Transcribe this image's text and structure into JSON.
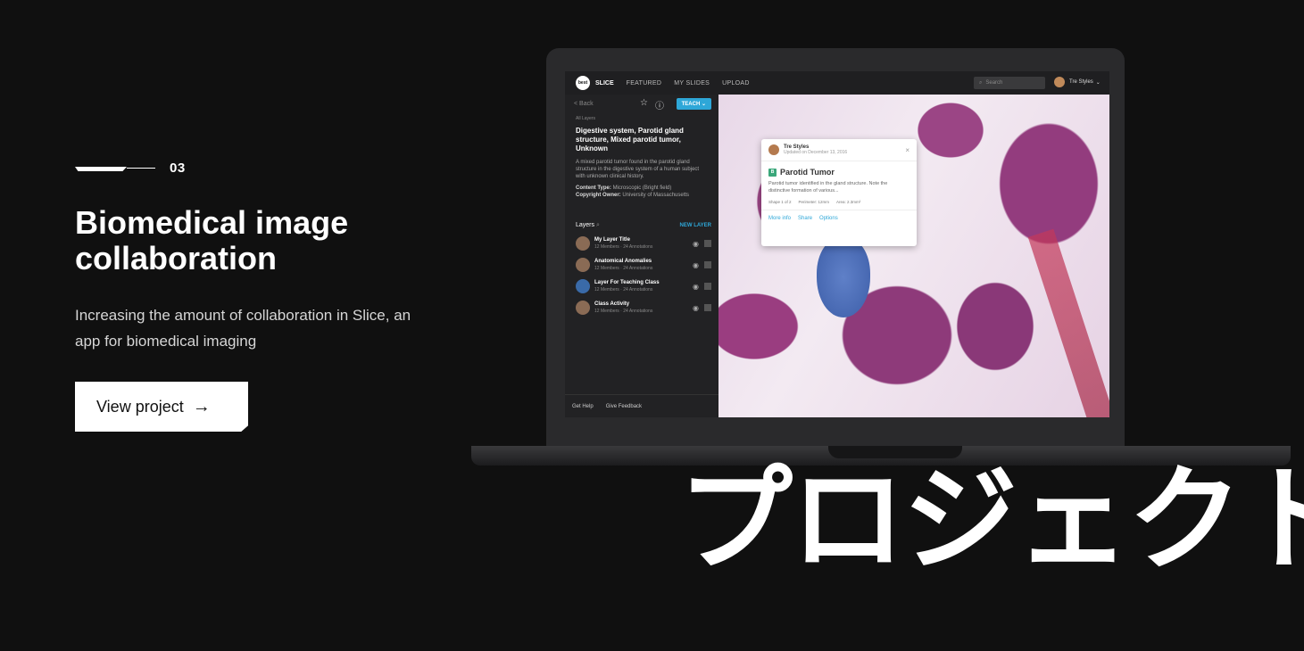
{
  "section": {
    "number": "03",
    "title": "Biomedical image collaboration",
    "description": "Increasing the amount of collaboration in Slice, an app for biomedical imaging",
    "cta_label": "View project",
    "cta_icon": "arrow-right-icon"
  },
  "overlay_text": "プロジェクト",
  "app": {
    "logo_text": "best",
    "brand": "SLICE",
    "nav": [
      "FEATURED",
      "MY SLIDES",
      "UPLOAD"
    ],
    "search_placeholder": "Search",
    "user_name": "Tre Styles",
    "back_label": "< Back",
    "teach_label": "TEACH",
    "breadcrumb": "All Layers",
    "slide_title": "Digestive system, Parotid gland structure, Mixed parotid tumor, Unknown",
    "slide_description": "A mixed parotid tumor found in the parotid gland structure in the digestive system of a human subject with unknown clinical history.",
    "content_type_label": "Content Type:",
    "content_type": "Microscopic (Bright field)",
    "copyright_label": "Copyright Owner:",
    "copyright": "University of Massachusetts",
    "layers_label": "Layers",
    "new_layer_label": "NEW LAYER",
    "layers": [
      {
        "name": "My Layer Title",
        "meta": "12 Members · 24 Annotations"
      },
      {
        "name": "Anatomical Anomalies",
        "meta": "12 Members · 24 Annotations"
      },
      {
        "name": "Layer For Teaching Class",
        "meta": "12 Members · 24 Annotations"
      },
      {
        "name": "Class Activity",
        "meta": "12 Members · 24 Annotations"
      }
    ],
    "footer": [
      "Get Help",
      "Give Feedback"
    ],
    "popup": {
      "author": "Tre Styles",
      "date": "Updated on December 13, 2016",
      "badge": "B",
      "title": "Parotid Tumor",
      "description": "Parotid tumor identified in the gland structure. Note the distinctive formation of various...",
      "stats": [
        "Shape 1 of 2",
        "Perimeter: 12mm",
        "Area: 2.3mm²"
      ],
      "links": [
        "More info",
        "Share",
        "Options"
      ]
    }
  },
  "colors": {
    "background": "#101010",
    "accent": "#2ea7d8"
  }
}
